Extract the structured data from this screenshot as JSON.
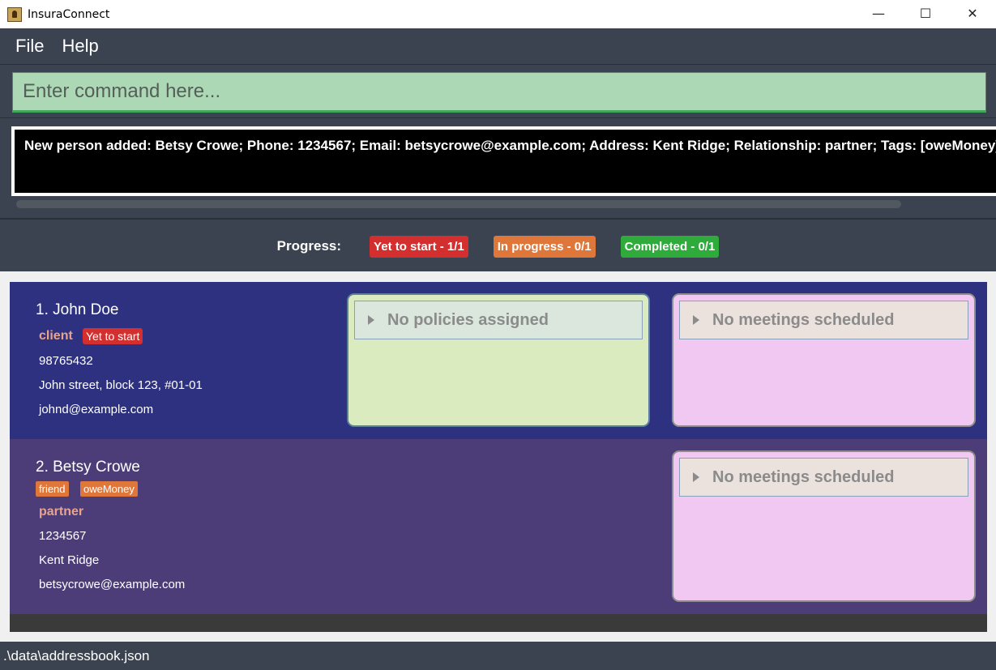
{
  "window": {
    "title": "InsuraConnect",
    "minimize_icon": "—",
    "maximize_icon": "☐",
    "close_icon": "✕"
  },
  "menu": {
    "file": "File",
    "help": "Help"
  },
  "command": {
    "placeholder": "Enter command here..."
  },
  "result": {
    "text": "New person added: Betsy Crowe; Phone: 1234567; Email: betsycrowe@example.com; Address: Kent Ridge; Relationship: partner; Tags: [oweMoney][friend]"
  },
  "progress": {
    "label": "Progress:",
    "yet_to_start": "Yet to start - 1/1",
    "in_progress": "In progress - 0/1",
    "completed": "Completed - 0/1",
    "colors": {
      "yet_to_start": "#d32f2f",
      "in_progress": "#e0773a",
      "completed": "#2eab3a"
    }
  },
  "persons": [
    {
      "index_name": "1.  John Doe",
      "relationship": "client",
      "status": "Yet to start",
      "phone": "98765432",
      "address": "John street, block 123, #01-01",
      "email": "johnd@example.com",
      "policies": "No policies assigned",
      "meetings": "No meetings scheduled"
    },
    {
      "index_name": "2.  Betsy Crowe",
      "tags": [
        "friend",
        "oweMoney"
      ],
      "relationship": "partner",
      "phone": "1234567",
      "address": "Kent Ridge",
      "email": "betsycrowe@example.com",
      "meetings": "No meetings scheduled"
    }
  ],
  "statusbar": {
    "path": ".\\data\\addressbook.json"
  }
}
